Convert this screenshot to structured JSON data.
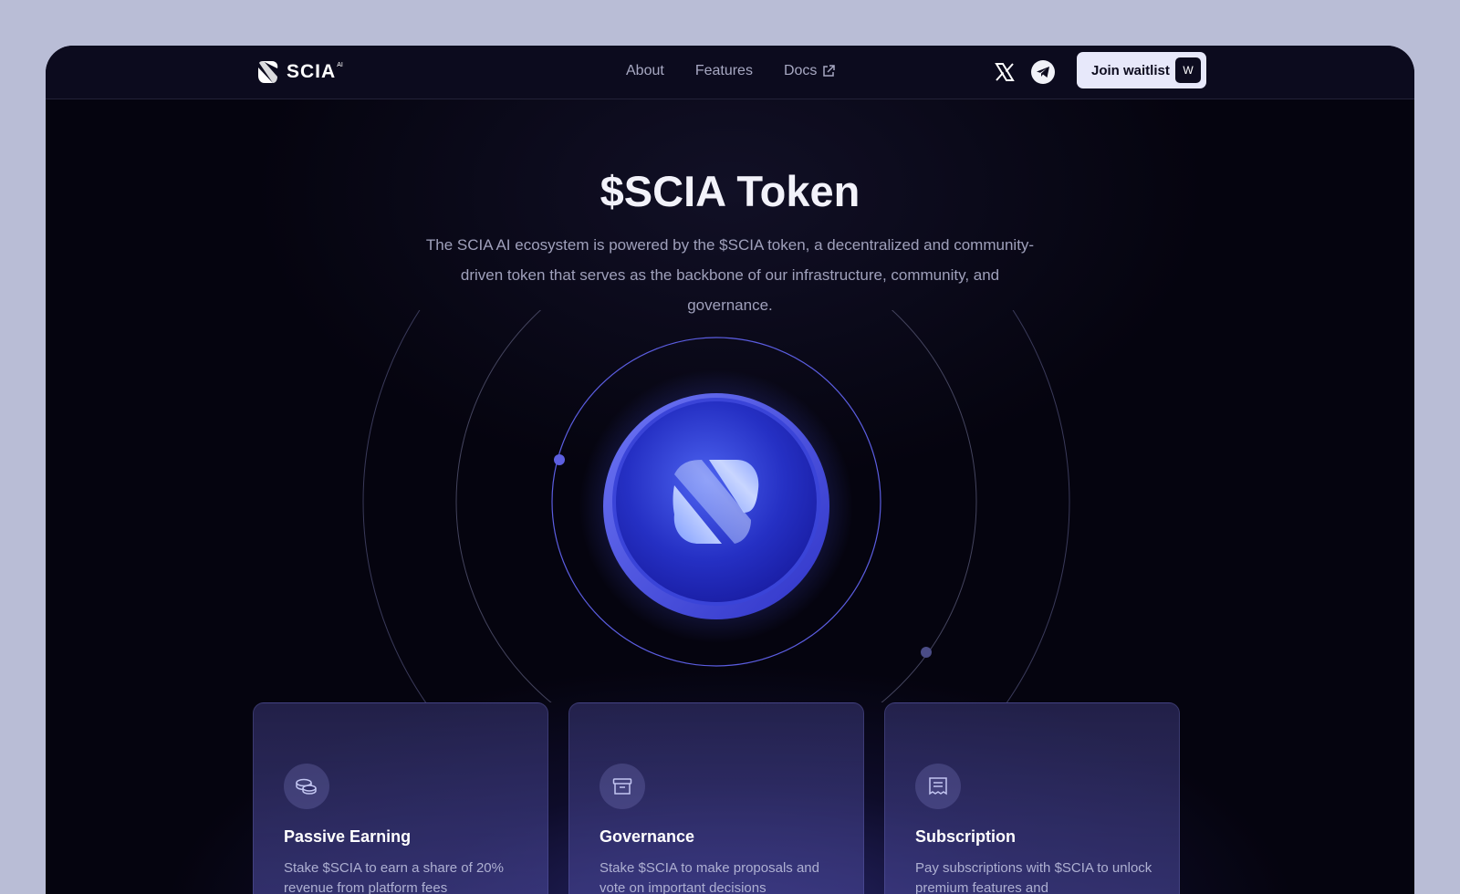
{
  "brand": {
    "name": "SCIA",
    "superscript": "AI"
  },
  "nav": {
    "links": [
      {
        "label": "About"
      },
      {
        "label": "Features"
      },
      {
        "label": "Docs"
      }
    ],
    "social": [
      "x-icon",
      "telegram-icon"
    ],
    "cta": {
      "label": "Join waitlist",
      "shortcut": "W"
    }
  },
  "hero": {
    "title": "$SCIA Token",
    "description": "The SCIA AI ecosystem is powered by the $SCIA token, a decentralized and community-driven token that serves as the backbone of our infrastructure, community, and governance."
  },
  "features": [
    {
      "icon": "coins-icon",
      "title": "Passive Earning",
      "text": "Stake $SCIA to earn a share of 20% revenue from platform fees"
    },
    {
      "icon": "archive-icon",
      "title": "Governance",
      "text": "Stake $SCIA to make proposals and vote on important decisions"
    },
    {
      "icon": "receipt-icon",
      "title": "Subscription",
      "text": "Pay subscriptions with $SCIA to unlock premium features and"
    }
  ],
  "colors": {
    "background": "#05040f",
    "navbar": "#0c0b1e",
    "accent": "#5d5fe0",
    "coin": "#2a2fc8",
    "button": "#e7e8fa"
  }
}
